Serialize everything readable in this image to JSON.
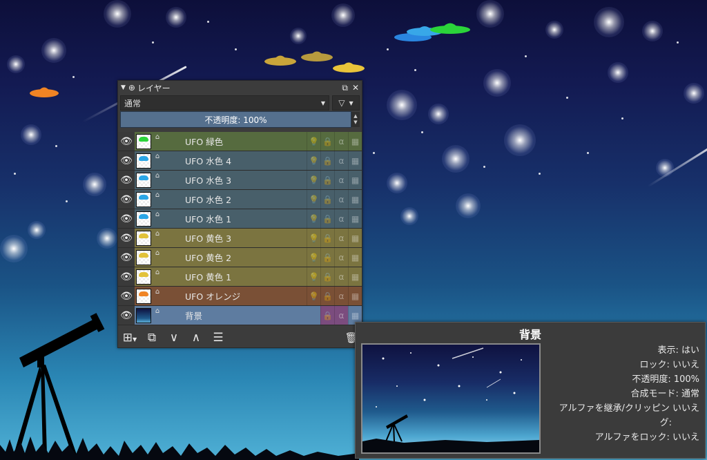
{
  "docker": {
    "title": "レイヤー",
    "blend_mode": "通常",
    "opacity_label": "不透明度:  100%",
    "layers": [
      {
        "name": "UFO 緑色",
        "color": "#566b3f",
        "thumb": "#2bd43a"
      },
      {
        "name": "UFO 水色 4",
        "color": "#485f6a",
        "thumb": "#2aa6e6"
      },
      {
        "name": "UFO 水色 3",
        "color": "#485f6a",
        "thumb": "#2aa6e6"
      },
      {
        "name": "UFO 水色 2",
        "color": "#485f6a",
        "thumb": "#2aa6e6"
      },
      {
        "name": "UFO 水色 1",
        "color": "#485f6a",
        "thumb": "#2aa6e6"
      },
      {
        "name": "UFO 黄色 3",
        "color": "#7b7440",
        "thumb": "#e2c23a"
      },
      {
        "name": "UFO 黄色 2",
        "color": "#7b7440",
        "thumb": "#e2c23a"
      },
      {
        "name": "UFO 黄色 1",
        "color": "#7b7440",
        "thumb": "#e2c23a"
      },
      {
        "name": "UFO オレンジ",
        "color": "#7a5036",
        "thumb": "#f08424"
      },
      {
        "name": "背景",
        "color": "#5e7ca0",
        "thumb": "#1c3a70"
      }
    ]
  },
  "tooltip": {
    "title": "背景",
    "info": [
      "表示: はい",
      "ロック: いいえ",
      "不透明度: 100%",
      "合成モード: 通常",
      "アルファを継承/クリッピン いいえ",
      "グ:",
      "アルファをロック: いいえ"
    ]
  },
  "icons": {
    "eye": "eye-icon",
    "alpha": "alpha-lock-icon",
    "lock": "lock-icon",
    "inherit": "inherit-alpha-icon"
  }
}
